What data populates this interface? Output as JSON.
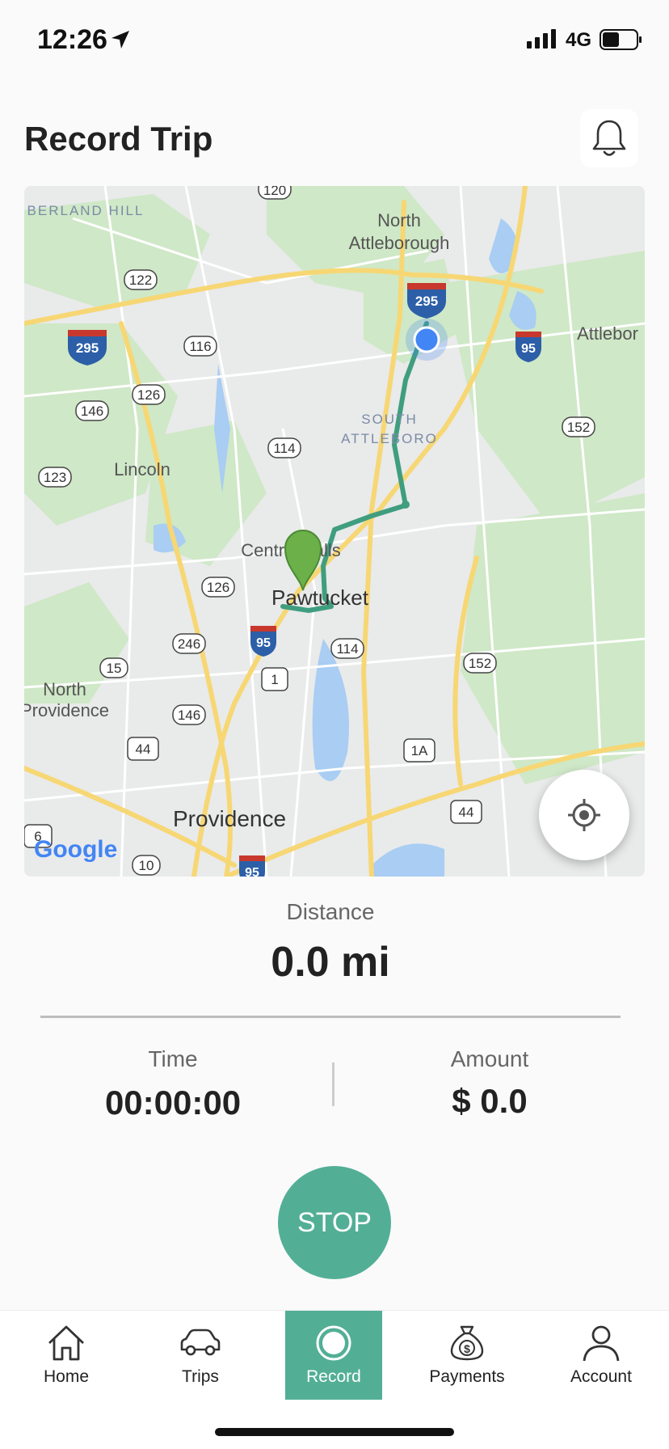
{
  "status": {
    "time": "12:26",
    "network": "4G"
  },
  "header": {
    "title": "Record Trip"
  },
  "map": {
    "places": [
      "BERLAND HILL",
      "North",
      "Attleborough",
      "Attlebor",
      "SOUTH",
      "ATTLEBORO",
      "Lincoln",
      "Central Falls",
      "Pawtucket",
      "North",
      "Providence",
      "Providence"
    ],
    "route_labels": [
      "120",
      "122",
      "295",
      "116",
      "126",
      "146",
      "123",
      "114",
      "295",
      "95",
      "152",
      "126",
      "246",
      "95",
      "114",
      "15",
      "1",
      "146",
      "44",
      "152",
      "1A",
      "44",
      "6",
      "10",
      "95"
    ],
    "brand": "Google"
  },
  "stats": {
    "distance_label": "Distance",
    "distance_value": "0.0 mi",
    "time_label": "Time",
    "time_value": "00:00:00",
    "amount_label": "Amount",
    "amount_value": "$ 0.0"
  },
  "actions": {
    "stop_label": "STOP"
  },
  "tabs": [
    {
      "label": "Home",
      "icon": "home-icon"
    },
    {
      "label": "Trips",
      "icon": "car-icon"
    },
    {
      "label": "Record",
      "icon": "record-icon"
    },
    {
      "label": "Payments",
      "icon": "money-bag-icon"
    },
    {
      "label": "Account",
      "icon": "person-icon"
    }
  ],
  "colors": {
    "accent": "#52af96",
    "route": "#3f9e7f",
    "location_dot": "#4285f4",
    "map_green": "#cfe8c7",
    "map_road": "#f7d774"
  }
}
